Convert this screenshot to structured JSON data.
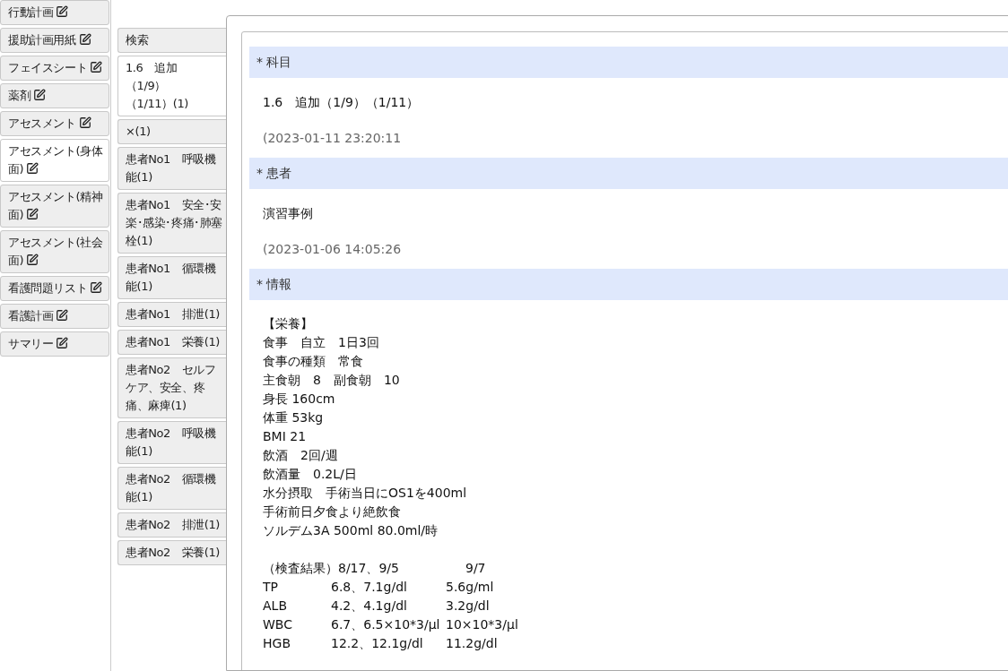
{
  "left_tabs": [
    {
      "label": "行動計画",
      "selected": false
    },
    {
      "label": "援助計画用紙",
      "selected": false
    },
    {
      "label": "フェイスシート",
      "selected": false
    },
    {
      "label": "薬剤",
      "selected": false
    },
    {
      "label": "アセスメント",
      "selected": false
    },
    {
      "label": "アセスメント(身体面)",
      "selected": true
    },
    {
      "label": "アセスメント(精神面)",
      "selected": false
    },
    {
      "label": "アセスメント(社会面)",
      "selected": false
    },
    {
      "label": "看護問題リスト",
      "selected": false
    },
    {
      "label": "看護計画",
      "selected": false
    },
    {
      "label": "サマリー",
      "selected": false
    }
  ],
  "record_tabs": [
    {
      "lines": [
        "検索"
      ],
      "selected": false
    },
    {
      "lines": [
        "1.6　追加",
        "（1/9）",
        "（1/11）(1)"
      ],
      "selected": true
    },
    {
      "lines": [
        "×(1)"
      ],
      "selected": false
    },
    {
      "lines": [
        "患者No1　呼吸機能(1)"
      ],
      "selected": false
    },
    {
      "lines": [
        "患者No1　安全･安楽･感染･疼痛･肺塞栓(1)"
      ],
      "selected": false
    },
    {
      "lines": [
        "患者No1　循環機能(1)"
      ],
      "selected": false
    },
    {
      "lines": [
        "患者No1　排泄(1)"
      ],
      "selected": false
    },
    {
      "lines": [
        "患者No1　栄養(1)"
      ],
      "selected": false
    },
    {
      "lines": [
        "患者No2　セルフケア、安全、疼痛、麻痺(1)"
      ],
      "selected": false
    },
    {
      "lines": [
        "患者No2　呼吸機能(1)"
      ],
      "selected": false
    },
    {
      "lines": [
        "患者No2　循環機能(1)"
      ],
      "selected": false
    },
    {
      "lines": [
        "患者No2　排泄(1)"
      ],
      "selected": false
    },
    {
      "lines": [
        "患者No2　栄養(1)"
      ],
      "selected": false
    }
  ],
  "sections": [
    {
      "title": "* 科目",
      "value": "1.6　追加（1/9）（1/11）",
      "timestamp": "(2023-01-11 23:20:11"
    },
    {
      "title": "* 患者",
      "value": "演習事例",
      "timestamp": "(2023-01-06 14:05:26"
    },
    {
      "title": "* 情報",
      "lines": [
        "【栄養】",
        "食事　自立　1日3回",
        "食事の種類　常食",
        "主食朝　8　副食朝　10",
        "身長 160cm",
        "体重 53kg",
        "BMI 21",
        "飲酒　2回/週",
        "飲酒量　0.2L/日",
        "水分摂取　手術当日にOS1を400ml",
        "手術前日夕食より絶飲食",
        "ソルデム3A 500ml 80.0ml/時"
      ],
      "labs": {
        "heading": "（検査結果）8/17、9/5",
        "date": "9/7",
        "rows": [
          {
            "name": "TP",
            "first": "6.8、7.1g/dl",
            "second": "5.6g/ml"
          },
          {
            "name": "ALB",
            "first": "4.2、4.1g/dl",
            "second": "3.2g/dl"
          },
          {
            "name": "WBC",
            "first": "6.7、6.5×10*3/μl",
            "second": "10×10*3/μl"
          },
          {
            "name": "HGB",
            "first": "12.2、12.1g/dl",
            "second": "11.2g/dl"
          }
        ]
      }
    }
  ]
}
